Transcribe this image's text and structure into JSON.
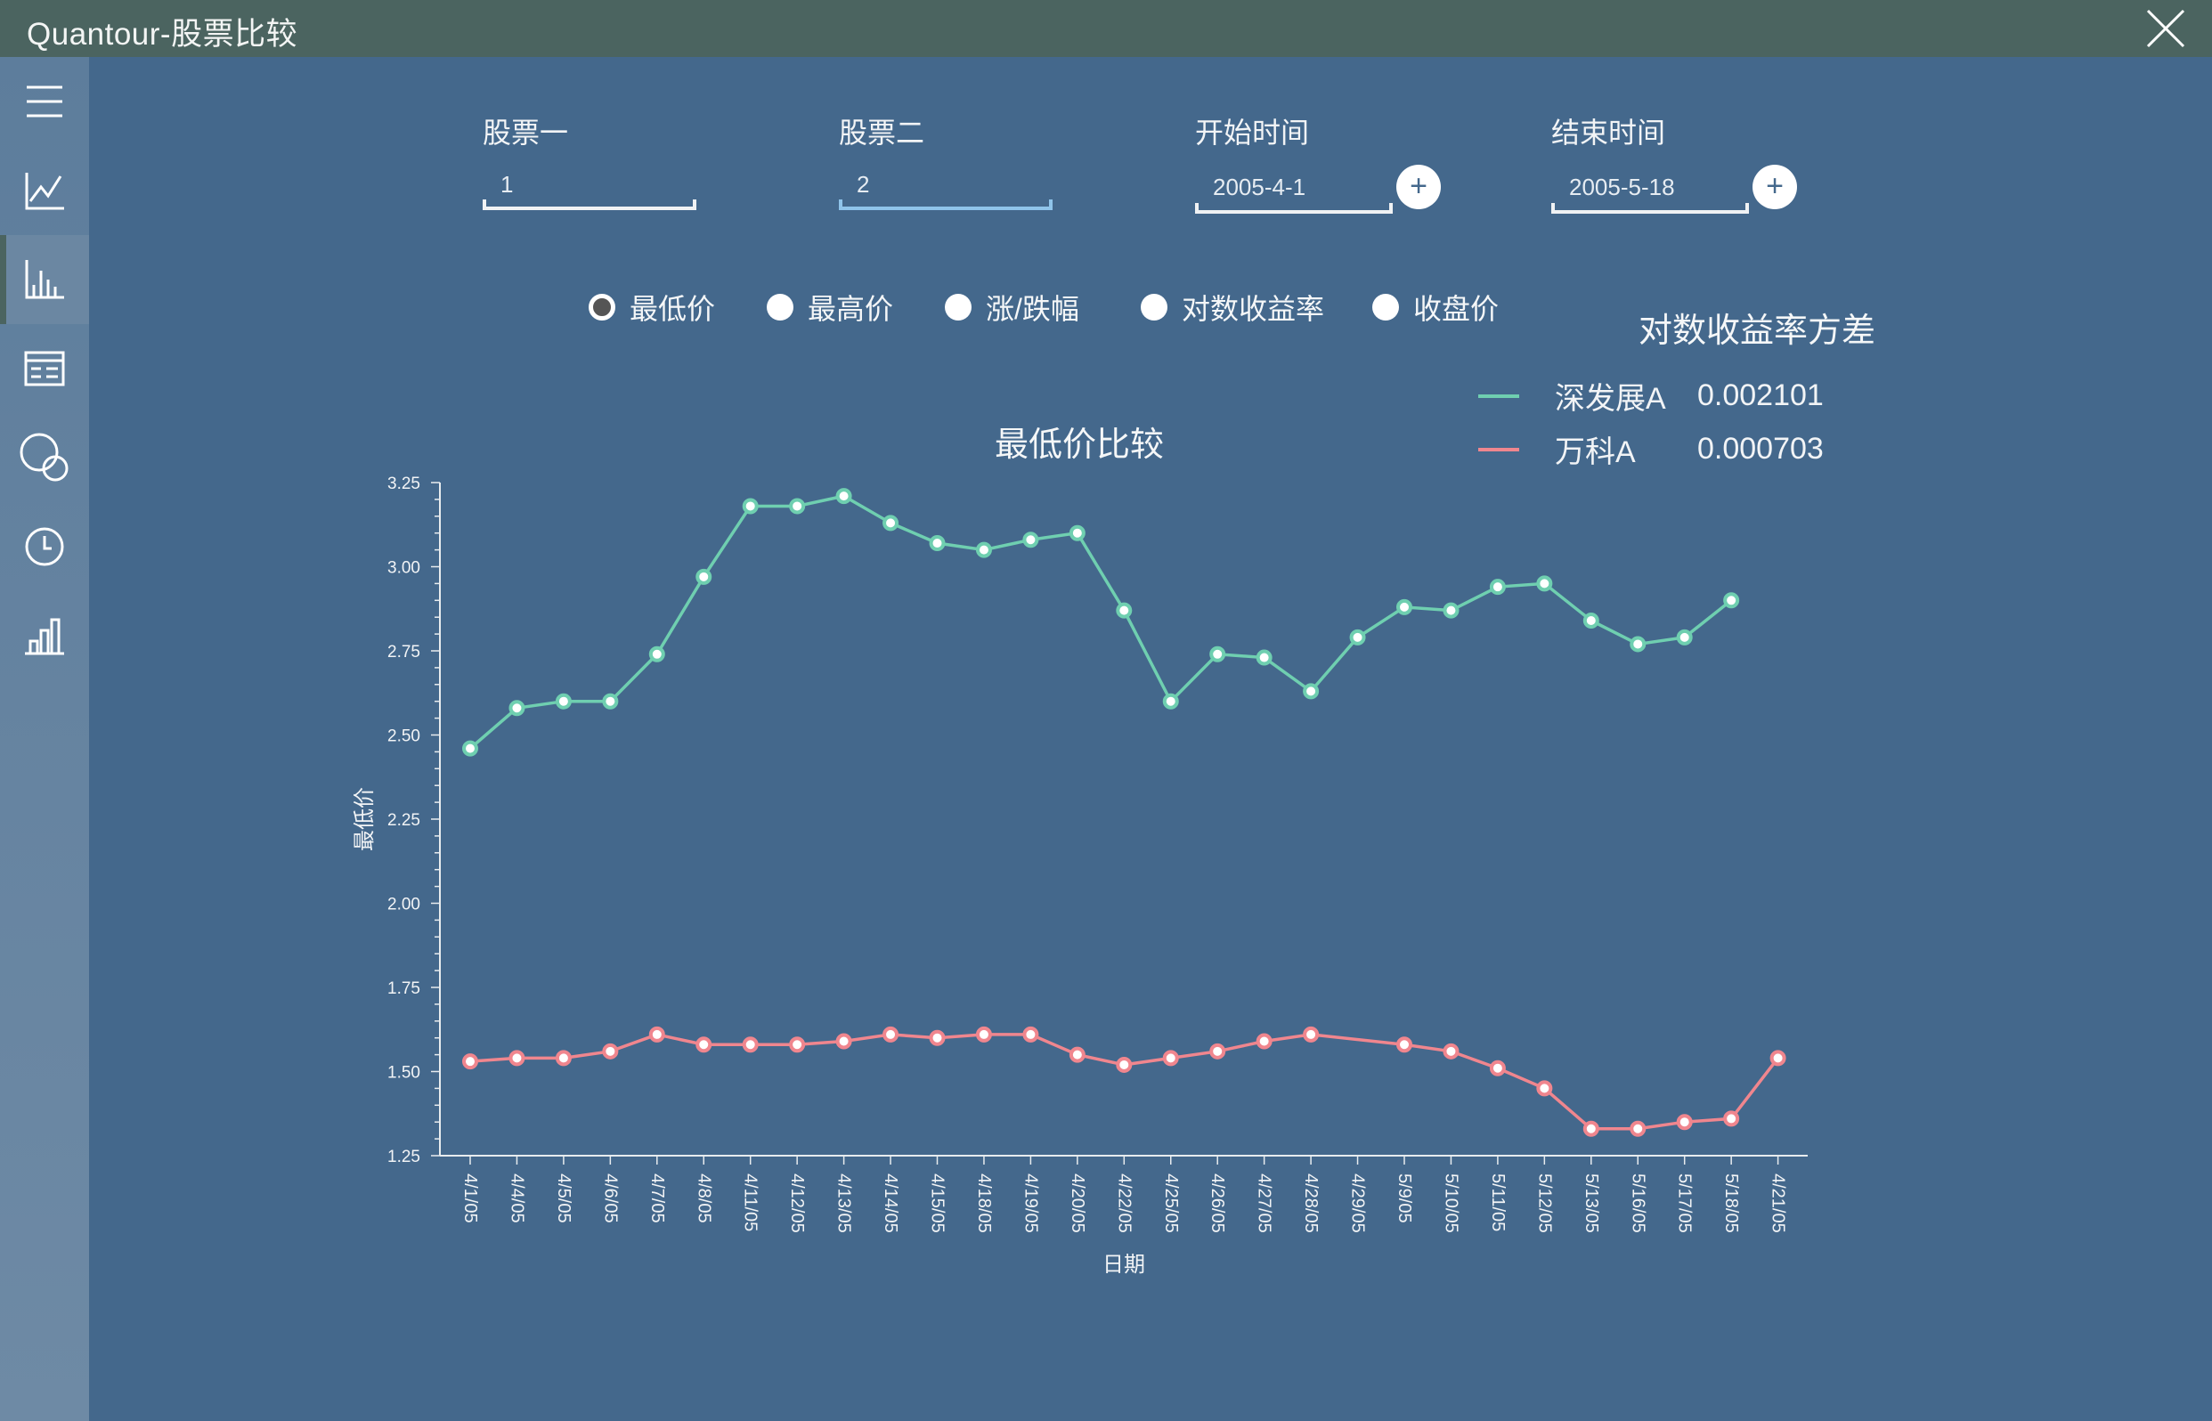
{
  "app": {
    "title": "Quantour-股票比较"
  },
  "sidebar": {
    "items": [
      {
        "icon": "menu-icon"
      },
      {
        "icon": "line-chart-icon"
      },
      {
        "icon": "bar-chart-icon",
        "active": true
      },
      {
        "icon": "table-list-icon"
      },
      {
        "icon": "circles-icon"
      },
      {
        "icon": "clock-icon"
      },
      {
        "icon": "histogram-icon"
      }
    ]
  },
  "form": {
    "stock1": {
      "label": "股票一",
      "value": "1"
    },
    "stock2": {
      "label": "股票二",
      "value": "2"
    },
    "start": {
      "label": "开始时间",
      "value": "2005-4-1"
    },
    "end": {
      "label": "结束时间",
      "value": "2005-5-18"
    },
    "plus": "+"
  },
  "radios": [
    {
      "label": "最低价",
      "checked": true
    },
    {
      "label": "最高价",
      "checked": false
    },
    {
      "label": "涨/跌幅",
      "checked": false
    },
    {
      "label": "对数收益率",
      "checked": false
    },
    {
      "label": "收盘价",
      "checked": false
    }
  ],
  "variance": {
    "title": "对数收益率方差",
    "rows": [
      {
        "name": "深发展A",
        "value": "0.002101",
        "color": "#6fcfb0"
      },
      {
        "name": "万科A",
        "value": "0.000703",
        "color": "#f0868e"
      }
    ]
  },
  "chart_data": {
    "type": "line",
    "title": "最低价比较",
    "xlabel": "日期",
    "ylabel": "最低价",
    "ylim": [
      1.25,
      3.25
    ],
    "yticks": [
      "1.25",
      "1.50",
      "1.75",
      "2.00",
      "2.25",
      "2.50",
      "2.75",
      "3.00",
      "3.25"
    ],
    "categories": [
      "4/1/05",
      "4/4/05",
      "4/5/05",
      "4/6/05",
      "4/7/05",
      "4/8/05",
      "4/11/05",
      "4/12/05",
      "4/13/05",
      "4/14/05",
      "4/15/05",
      "4/18/05",
      "4/19/05",
      "4/20/05",
      "4/22/05",
      "4/25/05",
      "4/26/05",
      "4/27/05",
      "4/28/05",
      "4/29/05",
      "5/9/05",
      "5/10/05",
      "5/11/05",
      "5/12/05",
      "5/13/05",
      "5/16/05",
      "5/17/05",
      "5/18/05",
      "4/21/05"
    ],
    "series": [
      {
        "name": "深发展A",
        "color": "#6fcfb0",
        "values": [
          2.46,
          2.58,
          2.6,
          2.6,
          2.74,
          2.97,
          3.18,
          3.18,
          3.21,
          3.13,
          3.07,
          3.05,
          3.08,
          3.1,
          2.87,
          2.6,
          2.74,
          2.73,
          2.63,
          2.79,
          2.88,
          2.87,
          2.94,
          2.95,
          2.84,
          2.77,
          2.79,
          2.9,
          null
        ]
      },
      {
        "name": "万科A",
        "color": "#f0868e",
        "values": [
          1.53,
          1.54,
          1.54,
          1.56,
          1.61,
          1.58,
          1.58,
          1.58,
          1.59,
          1.61,
          1.6,
          1.61,
          1.61,
          1.55,
          1.52,
          1.54,
          1.56,
          1.59,
          1.61,
          null,
          1.58,
          1.56,
          1.51,
          1.45,
          1.33,
          1.33,
          1.35,
          1.36,
          1.54
        ]
      }
    ],
    "grid": false
  }
}
